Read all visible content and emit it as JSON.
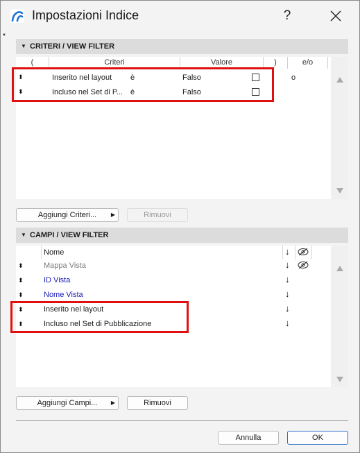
{
  "window": {
    "title": "Impostazioni Indice",
    "help": "?"
  },
  "criteria_section": {
    "header": "CRITERI /  VIEW FILTER",
    "columns": {
      "open_paren": "(",
      "criteria": "Criteri",
      "value": "Valore",
      "close_paren": ")",
      "and_or": "e/o"
    },
    "rows": [
      {
        "criterion": "Inserito nel layout",
        "operator": "è",
        "value": "Falso",
        "checked": false,
        "and_or": "o"
      },
      {
        "criterion": "Incluso nel Set di P...",
        "operator": "è",
        "value": "Falso",
        "checked": false,
        "and_or": ""
      }
    ],
    "add_button": "Aggiungi Criteri...",
    "remove_button": "Rimuovi"
  },
  "fields_section": {
    "header": "CAMPI /  VIEW FILTER",
    "header_row": {
      "label": "Nome",
      "sort": "↓"
    },
    "rows": [
      {
        "label": "Mappa Vista",
        "sort": "↓",
        "color": "#7a7a7a",
        "hidden": true
      },
      {
        "label": "ID Vista",
        "sort": "↓",
        "color": "#1a1ab0",
        "hidden": false
      },
      {
        "label": "Nome Vista",
        "sort": "↓",
        "color": "#1a1ab0",
        "hidden": false
      },
      {
        "label": "Inserito nel layout",
        "sort": "↓",
        "color": "#111111",
        "hidden": false
      },
      {
        "label": "Incluso nel Set di Pubblicazione",
        "sort": "↓",
        "color": "#111111",
        "hidden": false
      }
    ],
    "add_button": "Aggiungi Campi...",
    "remove_button": "Rimuovi"
  },
  "footer": {
    "cancel": "Annulla",
    "ok": "OK"
  },
  "colors": {
    "highlight": "#e01010",
    "accent": "#2b6dc9"
  }
}
